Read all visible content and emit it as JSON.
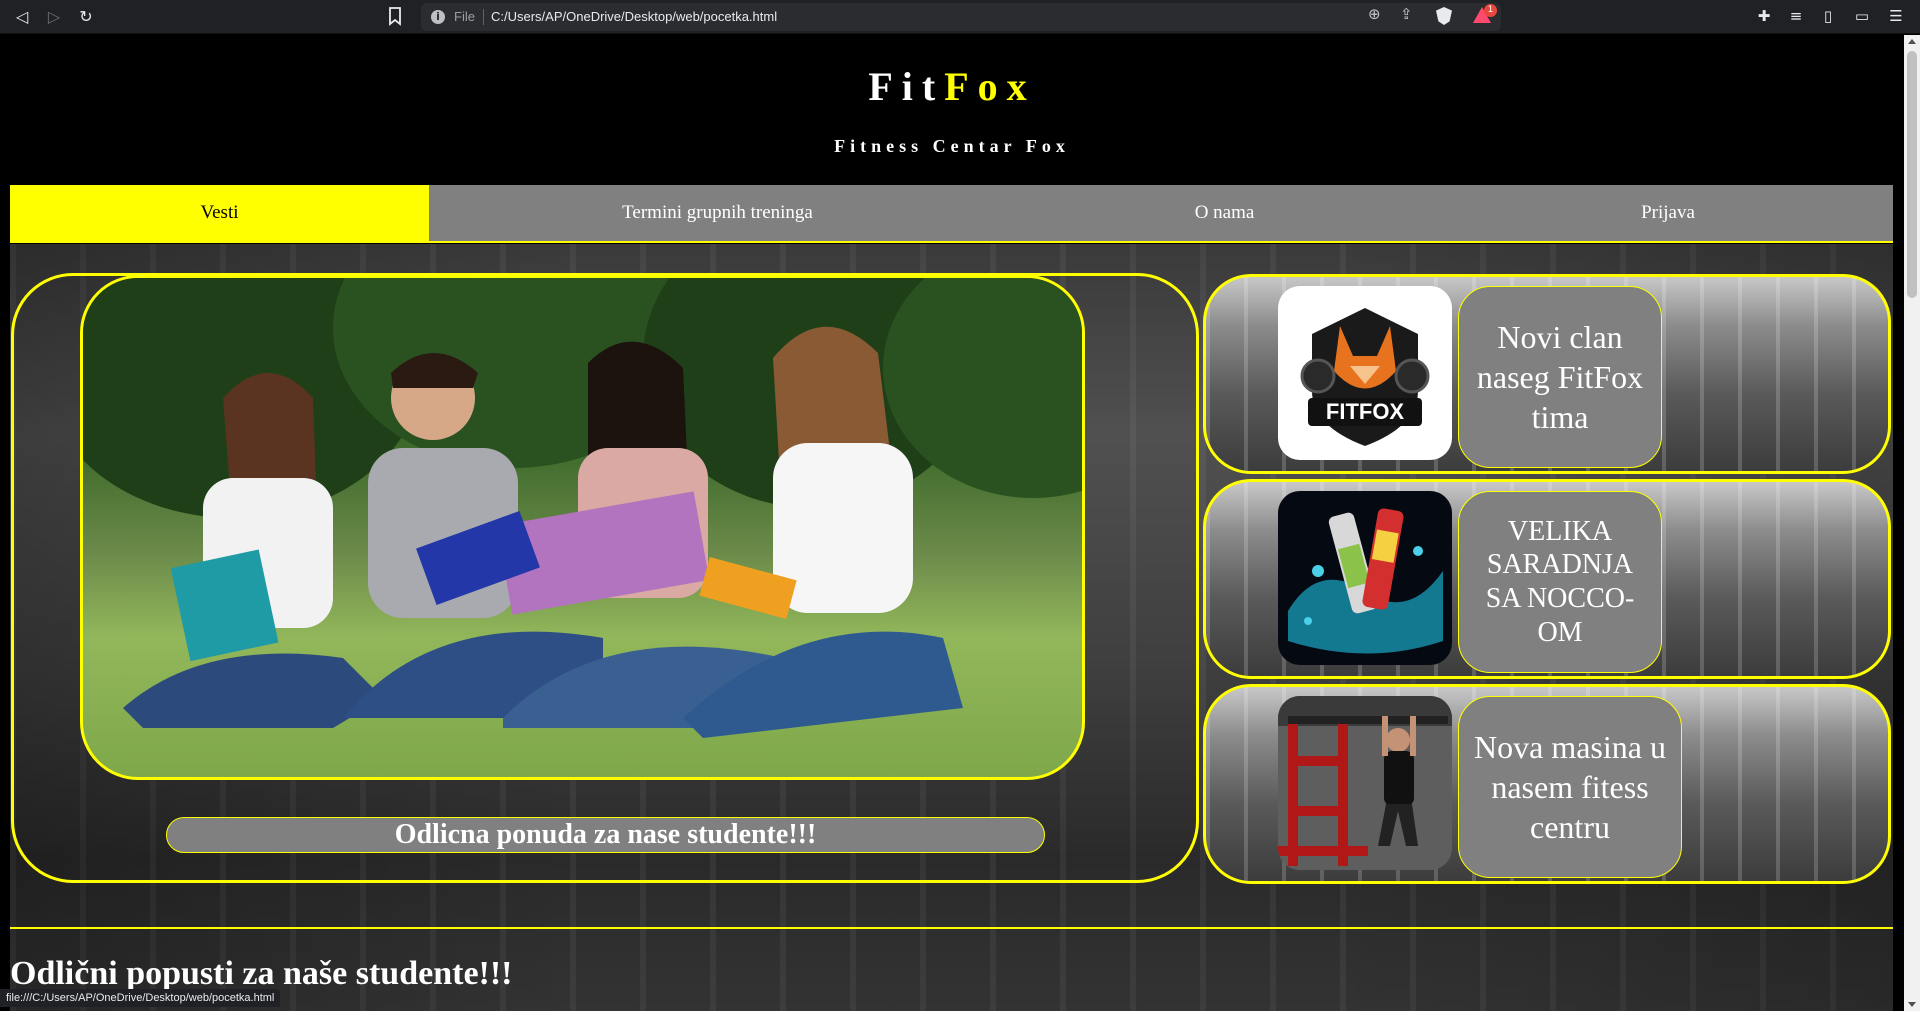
{
  "browser": {
    "scheme_label": "File",
    "url": "C:/Users/AP/OneDrive/Desktop/web/pocetka.html",
    "rewards_count": "1",
    "status_url": "file:///C:/Users/AP/OneDrive/Desktop/web/pocetka.html"
  },
  "header": {
    "title_part1": "Fit",
    "title_part2": "Fox",
    "subtitle": "Fitness Centar Fox"
  },
  "menu": {
    "items": [
      {
        "label": "Vesti",
        "active": true
      },
      {
        "label": "Termini grupnih treninga"
      },
      {
        "label": "O nama"
      },
      {
        "label": "Prijava"
      }
    ]
  },
  "featured": {
    "caption": "Odlicna ponuda za nase studente!!!"
  },
  "news": [
    {
      "text": "Novi clan naseg FitFox tima",
      "logo_text": "FITFOX"
    },
    {
      "text": "VELIKA SARADNJA SA NOCCO-OM"
    },
    {
      "text": "Nova masina u nasem fitess centru"
    }
  ],
  "section": {
    "title": "Odlični popusti za naše studente!!!"
  },
  "colors": {
    "accent": "#ffff00",
    "menu_bg": "#808080",
    "page_bg": "#000000"
  }
}
